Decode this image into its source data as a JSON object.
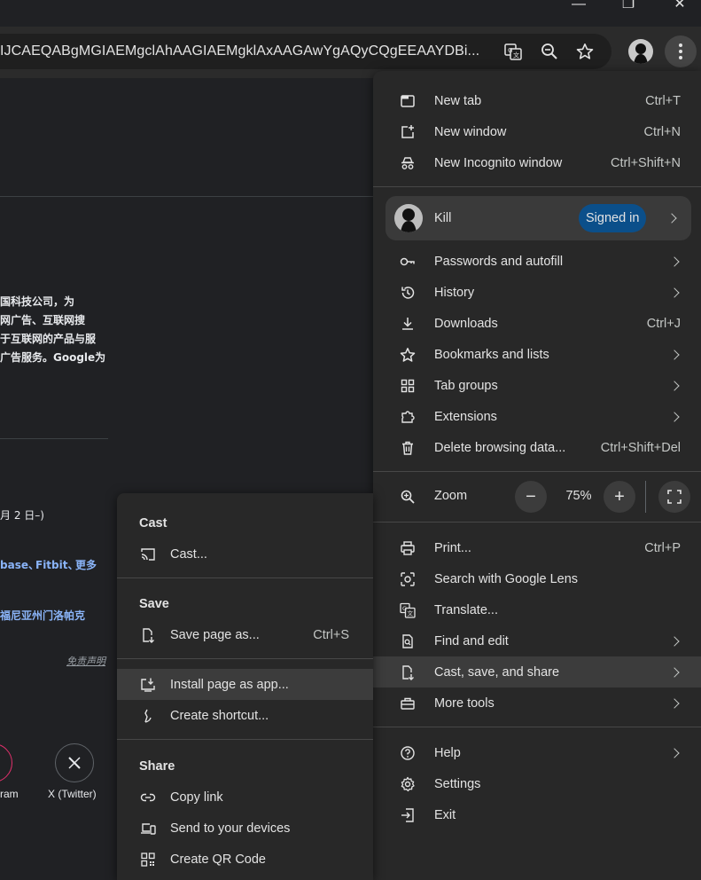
{
  "window": {
    "minimize": "—",
    "maximize": "❐",
    "close": "✕"
  },
  "toolbar": {
    "url": "IJCAEQABgMGIAEMgclAhAAGIAEMgklAxAAGAwYgAQyCQgEEAAYDBi...",
    "icons": [
      "translate-icon",
      "zoom-icon",
      "bookmark-star-icon",
      "avatar",
      "more-menu-icon"
    ]
  },
  "page": {
    "cjk_lines": [
      "国科技公司，为",
      "网广告、互联网搜",
      "于互联网的产品与服",
      "广告服务。Google为"
    ],
    "date_fragment": "月 2 日–)",
    "links_line_prefix": "base、",
    "links": [
      "Fitbit、",
      "更多"
    ],
    "location_line": "福尼亚州门洛帕克",
    "disclaimer": "免责声明",
    "social": [
      {
        "label": "ram",
        "icon": "instagram-icon"
      },
      {
        "label": "X (Twitter)",
        "icon": "x-twitter-icon"
      }
    ]
  },
  "main_menu": {
    "items_top": [
      {
        "label": "New tab",
        "shortcut": "Ctrl+T",
        "icon": "new-tab-icon"
      },
      {
        "label": "New window",
        "shortcut": "Ctrl+N",
        "icon": "new-window-icon"
      },
      {
        "label": "New Incognito window",
        "shortcut": "Ctrl+Shift+N",
        "icon": "incognito-icon"
      }
    ],
    "profile": {
      "name": "Kill",
      "badge": "Signed in"
    },
    "items_mid": [
      {
        "label": "Passwords and autofill",
        "icon": "key-icon",
        "submenu": true
      },
      {
        "label": "History",
        "icon": "history-icon",
        "submenu": true
      },
      {
        "label": "Downloads",
        "shortcut": "Ctrl+J",
        "icon": "download-icon"
      },
      {
        "label": "Bookmarks and lists",
        "icon": "star-icon",
        "submenu": true
      },
      {
        "label": "Tab groups",
        "icon": "tab-groups-icon",
        "submenu": true
      },
      {
        "label": "Extensions",
        "icon": "puzzle-icon",
        "submenu": true
      },
      {
        "label": "Delete browsing data...",
        "shortcut": "Ctrl+Shift+Del",
        "icon": "trash-icon"
      }
    ],
    "zoom": {
      "label": "Zoom",
      "value": "75%",
      "minus": "−",
      "plus": "+"
    },
    "items_tools": [
      {
        "label": "Print...",
        "shortcut": "Ctrl+P",
        "icon": "print-icon"
      },
      {
        "label": "Search with Google Lens",
        "icon": "lens-icon"
      },
      {
        "label": "Translate...",
        "icon": "translate-icon"
      },
      {
        "label": "Find and edit",
        "icon": "find-icon",
        "submenu": true
      },
      {
        "label": "Cast, save, and share",
        "icon": "cast-save-icon",
        "submenu": true,
        "highlighted": true
      },
      {
        "label": "More tools",
        "icon": "toolbox-icon",
        "submenu": true
      }
    ],
    "items_bottom": [
      {
        "label": "Help",
        "icon": "help-icon",
        "submenu": true
      },
      {
        "label": "Settings",
        "icon": "gear-icon"
      },
      {
        "label": "Exit",
        "icon": "exit-icon"
      }
    ]
  },
  "sub_menu": {
    "cast_header": "Cast",
    "cast_item": {
      "label": "Cast...",
      "icon": "cast-icon"
    },
    "save_header": "Save",
    "save_items": [
      {
        "label": "Save page as...",
        "shortcut": "Ctrl+S",
        "icon": "save-page-icon"
      },
      {
        "label": "Install page as app...",
        "icon": "install-app-icon",
        "highlighted": true
      },
      {
        "label": "Create shortcut...",
        "icon": "shortcut-icon"
      }
    ],
    "share_header": "Share",
    "share_items": [
      {
        "label": "Copy link",
        "icon": "link-icon"
      },
      {
        "label": "Send to your devices",
        "icon": "devices-icon"
      },
      {
        "label": "Create QR Code",
        "icon": "qr-code-icon"
      }
    ]
  }
}
